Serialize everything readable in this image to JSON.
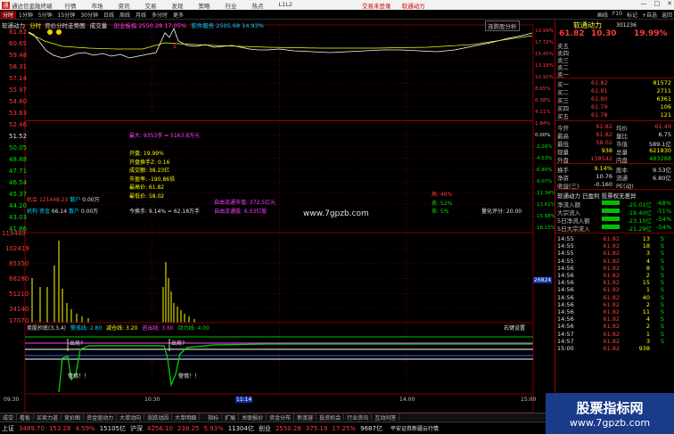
{
  "titlebar": {
    "app_name": "通达信金融终端",
    "menu": [
      "行情",
      "市场",
      "资讯",
      "交易",
      "发现",
      "策略",
      "行业",
      "热点",
      "L1L2"
    ],
    "center_items": [
      "交易未登录",
      "软通动力"
    ],
    "win_buttons": [
      "—",
      "□",
      "✕"
    ]
  },
  "toolbar": {
    "tabs": [
      "分时",
      "1分钟",
      "5分钟",
      "15分钟",
      "30分钟",
      "日线",
      "周线",
      "月线",
      "多分时",
      "更多"
    ],
    "right_items": [
      "画线",
      "F10",
      "标记",
      "+自选",
      "返回"
    ]
  },
  "header": {
    "stock": "软通动力",
    "mode": "分时",
    "mode2": "竞价分时走势图",
    "vol_label": "成交量",
    "index_info": "创业板指 2550.28 17.05%",
    "sector_info": "软件服务 2505.68 14.93%",
    "right_link": "连跌股分析"
  },
  "price_axis_left": [
    "61.82",
    "60.65",
    "59.48",
    "58.31",
    "57.14",
    "55.97",
    "54.80",
    "53.63",
    "52.46",
    "51.52",
    "50.05",
    "48.88",
    "47.71",
    "46.54",
    "45.37",
    "44.20",
    "43.03",
    "41.86"
  ],
  "price_axis_right": [
    "19.99%",
    "17.72%",
    "15.45%",
    "13.18%",
    "10.92%",
    "8.65%",
    "6.38%",
    "4.11%",
    "1.84%",
    "0.00%",
    "-2.26%",
    "-4.53%",
    "-6.80%",
    "-9.07%",
    "-11.34%",
    "-13.61%",
    "-15.88%",
    "-18.15%"
  ],
  "vol_axis_left": [
    "119489",
    "102419",
    "85350",
    "68280",
    "51210",
    "34140",
    "17070"
  ],
  "vol_right_value": "26824",
  "info_box": {
    "line0": "最大: 9353手 = 5163.8万元",
    "lines": [
      "开盘: 19.99%",
      "开盘换手Z: 0.16",
      "成交额: 38.23亿",
      "市盈率: -190.86倍",
      "最高价: 61.82",
      "最低价: 58.02"
    ],
    "left_tag1_a": "机会",
    "left_tag1_b": "121448.23",
    "left_tag1_c": "散户",
    "left_tag1_d": "0.00万",
    "left_tag2_a": "机构",
    "left_tag2_b": "资金",
    "left_tag2_c": "66.14",
    "left_tag2_d": "散户",
    "left_tag2_e": "0.00万",
    "turnover": "今换手: 9.14% = 62.18万手",
    "free_float1": "自由流通市值: 372.5亿元",
    "free_float2": "自由流通股: 6.03亿股",
    "watermark_mid": "www.7gpzb.com",
    "right_stat1": "高: 46%",
    "right_stat2": "卖: 52%",
    "right_stat3": "差: 5%",
    "right_stat4": "量化评分: 20.00"
  },
  "indicator": {
    "title": "卖股抄底(3,3,4)",
    "label1": "警戒线: 2.80",
    "label2": "减仓线: 3.20",
    "label3": "逃出线: 3.60",
    "label4": "动力线: 4.00",
    "right_label": "右键设置",
    "sig_out1": "出局?",
    "sig_out2": "出局?",
    "sig_warn1": "警惕！！",
    "sig_warn2": "警惕！！"
  },
  "time_axis": [
    "09:30",
    "10:30",
    "11:14",
    "14:00",
    "15:00"
  ],
  "right_panel": {
    "title": "软通动力",
    "code": "301236",
    "price": "61.82",
    "change": "10.30",
    "pct": "19.99%",
    "asks": [
      {
        "label": "卖五",
        "price": "",
        "vol": ""
      },
      {
        "label": "卖四",
        "price": "",
        "vol": ""
      },
      {
        "label": "卖三",
        "price": "",
        "vol": ""
      },
      {
        "label": "卖二",
        "price": "",
        "vol": ""
      },
      {
        "label": "卖一",
        "price": "",
        "vol": ""
      }
    ],
    "bids": [
      {
        "label": "买一",
        "price": "61.82",
        "vol": "81572"
      },
      {
        "label": "买二",
        "price": "61.81",
        "vol": "2711"
      },
      {
        "label": "买三",
        "price": "61.80",
        "vol": "6361"
      },
      {
        "label": "买四",
        "price": "61.79",
        "vol": "106"
      },
      {
        "label": "买五",
        "price": "61.78",
        "vol": "121"
      }
    ],
    "stats": [
      {
        "l1": "今开",
        "v1": "61.82",
        "l2": "均价",
        "v2": "61.49"
      },
      {
        "l1": "最高",
        "v1": "61.82",
        "l2": "量比",
        "v2": "6.75"
      },
      {
        "l1": "最低",
        "v1": "58.02",
        "l2": "市值",
        "v2": "589.1亿"
      },
      {
        "l1": "现量",
        "v1": "938",
        "l2": "总量",
        "v2": "621830"
      },
      {
        "l1": "外盘",
        "v1": "138542",
        "l2": "内盘",
        "v2": "483288"
      },
      {
        "l1": "换手",
        "v1": "9.14%",
        "l2": "股本",
        "v2": "9.53亿"
      },
      {
        "l1": "净资",
        "v1": "10.76",
        "l2": "流通",
        "v2": "6.80亿"
      },
      {
        "l1": "收益(三)",
        "v1": "-0.160",
        "l2": "PE(动)",
        "v2": ""
      }
    ],
    "fund_title": "软通动力 已盈利 投票权无差异",
    "fund_rows": [
      {
        "label": "净流入额",
        "val": "-25.01亿",
        "pct": "-68%"
      },
      {
        "label": "大宗流入",
        "val": "-19.40亿",
        "pct": "-51%"
      },
      {
        "label": "5日净流入额",
        "val": "-23.10亿",
        "pct": "-54%"
      },
      {
        "label": "5日大宗流入",
        "val": "-21.29亿",
        "pct": "-54%"
      }
    ],
    "ticks": [
      {
        "t": "14:55",
        "p": "61.82",
        "v": "13",
        "d": "S"
      },
      {
        "t": "14:55",
        "p": "61.82",
        "v": "18",
        "d": "S"
      },
      {
        "t": "14:55",
        "p": "61.82",
        "v": "3",
        "d": "S"
      },
      {
        "t": "14:55",
        "p": "61.82",
        "v": "4",
        "d": "S"
      },
      {
        "t": "14:56",
        "p": "61.82",
        "v": "8",
        "d": "S"
      },
      {
        "t": "14:56",
        "p": "61.82",
        "v": "2",
        "d": "S"
      },
      {
        "t": "14:56",
        "p": "61.82",
        "v": "15",
        "d": "S"
      },
      {
        "t": "14:56",
        "p": "61.82",
        "v": "1",
        "d": "S"
      },
      {
        "t": "14:56",
        "p": "61.82",
        "v": "40",
        "d": "S"
      },
      {
        "t": "14:56",
        "p": "61.82",
        "v": "2",
        "d": "S"
      },
      {
        "t": "14:56",
        "p": "61.82",
        "v": "11",
        "d": "S"
      },
      {
        "t": "14:56",
        "p": "61.82",
        "v": "4",
        "d": "S"
      },
      {
        "t": "14:56",
        "p": "61.82",
        "v": "2",
        "d": "S"
      },
      {
        "t": "14:57",
        "p": "61.82",
        "v": "1",
        "d": "S"
      },
      {
        "t": "14:57",
        "p": "61.82",
        "v": "3",
        "d": "S"
      },
      {
        "t": "15:00",
        "p": "61.82",
        "v": "938",
        "d": ""
      }
    ]
  },
  "bottom_tabs": [
    "指标",
    "扩展",
    "关联报价",
    "资金分布",
    "新宽容",
    "投资机会",
    "行业资讯",
    "互动问答",
    "普通新闻精读",
    "大单操作",
    "选股机器",
    "相关成分"
  ],
  "bottom_tabs2": [
    "成交",
    "看板",
    "买卖力道",
    "竞价图",
    "资金驱动力",
    "大单动向",
    "涨跌动因",
    "大单明细"
  ],
  "ticker": [
    {
      "name": "上证",
      "val": "3489.70",
      "chg": "153.28",
      "pct": "4.59%",
      "amt": "15105亿",
      "color": "red"
    },
    {
      "name": "沪深",
      "val": "4256.10",
      "chg": "238.25",
      "pct": "5.93%",
      "amt": "11304亿",
      "color": "red"
    },
    {
      "name": "创业",
      "val": "2550.28",
      "chg": "375.19",
      "pct": "17.25%",
      "amt": "9687亿",
      "color": "red"
    }
  ],
  "ticker_right": "平安证券新疆云行情",
  "watermark": {
    "big": "股票指标网",
    "small": "www.7gpzb.com"
  },
  "colors": {
    "up": "#ff3b3b",
    "down": "#00e000",
    "grid": "#800000",
    "price_line": "#ffffff",
    "avg_line": "#ffff00"
  }
}
